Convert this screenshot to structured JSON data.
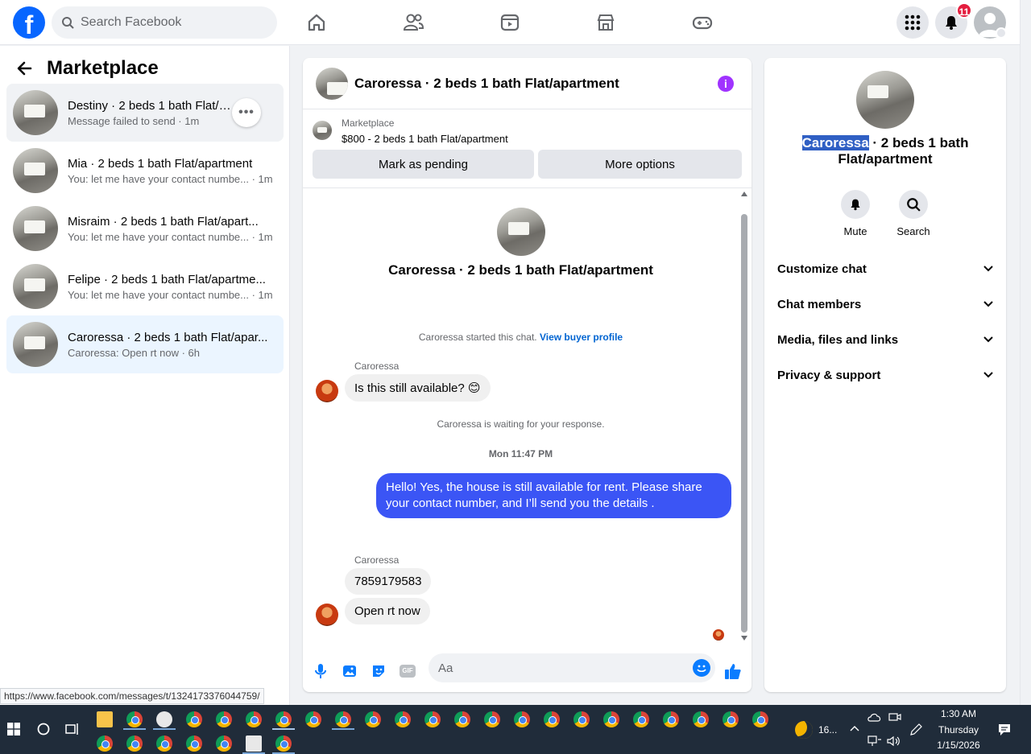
{
  "topbar": {
    "logo": "f",
    "search_placeholder": "Search Facebook",
    "notification_count": "11",
    "nav_icons": [
      "home-icon",
      "friends-icon",
      "video-icon",
      "marketplace-icon",
      "gaming-icon"
    ]
  },
  "sidebar": {
    "title": "Marketplace",
    "conversations": [
      {
        "title": "Destiny · 2 beds 1 bath Flat/apartment",
        "sub": "Message failed to send · 1m"
      },
      {
        "title": "Mia · 2 beds 1 bath Flat/apartment",
        "sub": "You: let me have your contact numbe... · 1m"
      },
      {
        "title": "Misraim · 2 beds 1 bath Flat/apart...",
        "sub": "You: let me have your contact numbe... · 1m"
      },
      {
        "title": "Felipe · 2 beds 1 bath Flat/apartme...",
        "sub": "You: let me have your contact numbe... · 1m"
      },
      {
        "title": "Caroressa · 2 beds 1 bath Flat/apar...",
        "sub": "Caroressa: Open rt now · 6h"
      }
    ],
    "more_label": "•••",
    "status_url": "https://www.facebook.com/messages/t/1324173376044759/"
  },
  "chat": {
    "header_title": "Caroressa · 2 beds 1 bath Flat/apartment",
    "info_label": "i",
    "listing_source": "Marketplace",
    "listing_price": "$800 - 2 beds 1 bath Flat/apartment",
    "mark_pending": "Mark as pending",
    "more_options": "More options",
    "center_title": "Caroressa · 2 beds 1 bath Flat/apartment",
    "started_text": "Caroressa started this chat.",
    "view_profile": "View buyer profile",
    "sender_name": "Caroressa",
    "msg_1": "Is this still available? 😊",
    "waiting_text": "Caroressa is waiting for your response.",
    "timestamp": "Mon 11:47 PM",
    "msg_out": "Hello! Yes, the house is still available for rent. Please share your contact number, and I’ll send you the details .",
    "sender_name_2": "Caroressa",
    "msg_2": "7859179583",
    "msg_3": "Open rt now",
    "composer_placeholder": "Aa",
    "composer_icons": [
      "microphone-icon",
      "photo-icon",
      "sticker-icon",
      "gif-icon",
      "emoji-icon",
      "thumbs-up-icon"
    ],
    "gif_label": "GIF"
  },
  "details": {
    "name_highlight": "Caroressa",
    "name_rest": " · 2 beds 1 bath Flat/apartment",
    "mute_label": "Mute",
    "search_label": "Search",
    "sections": [
      "Customize chat",
      "Chat members",
      "Media, files and links",
      "Privacy & support"
    ]
  },
  "taskbar": {
    "weather": "16...",
    "time": "1:30 AM",
    "day": "Thursday",
    "date": "1/15/2026"
  }
}
